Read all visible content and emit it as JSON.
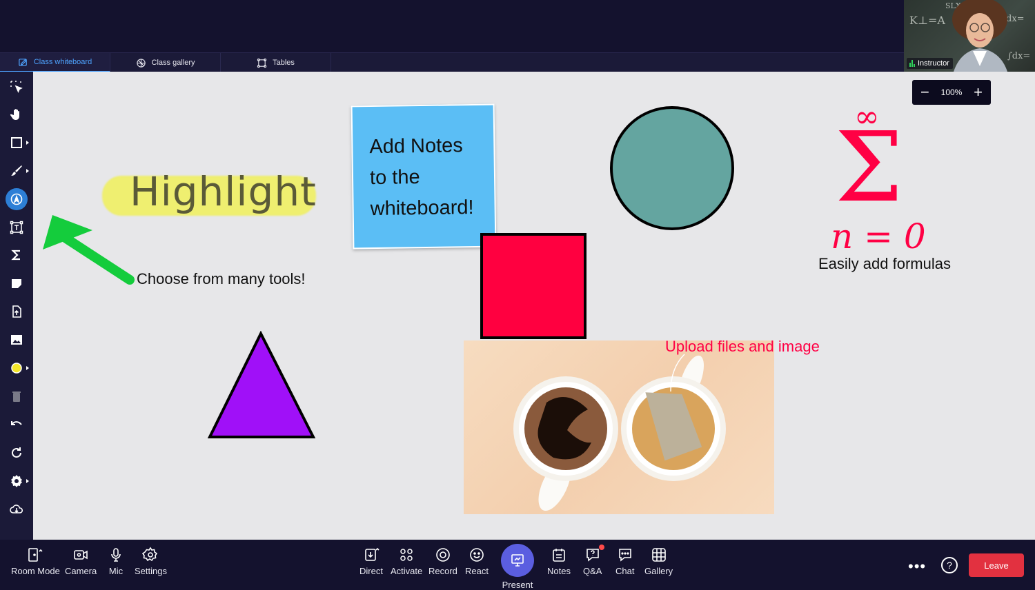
{
  "tabs": [
    {
      "label": "Class whiteboard",
      "icon": "whiteboard-icon",
      "active": true
    },
    {
      "label": "Class gallery",
      "icon": "grid-icon",
      "active": false
    },
    {
      "label": "Tables",
      "icon": "tables-icon",
      "active": false
    }
  ],
  "instructor": {
    "label": "Instructor"
  },
  "zoom": {
    "value": "100%",
    "minus": "−",
    "plus": "+"
  },
  "canvas": {
    "highlight_text": "Highlight",
    "tools_text": "Choose from many tools!",
    "sticky_lines": [
      "Add Notes",
      "to the",
      "whiteboard!"
    ],
    "formula_top": "∞",
    "formula_sigma": "Σ",
    "formula_bottom": "n = 0",
    "formula_label": "Easily add formulas",
    "upload_label": "Upload files and image"
  },
  "bottom_left": [
    {
      "label": "Room Mode",
      "icon": "room-mode-icon"
    },
    {
      "label": "Camera",
      "icon": "camera-icon"
    },
    {
      "label": "Mic",
      "icon": "mic-icon"
    },
    {
      "label": "Settings",
      "icon": "settings-icon"
    }
  ],
  "bottom_center": [
    {
      "label": "Direct",
      "icon": "direct-icon"
    },
    {
      "label": "Activate",
      "icon": "activate-icon"
    },
    {
      "label": "Record",
      "icon": "record-icon"
    },
    {
      "label": "React",
      "icon": "react-icon"
    },
    {
      "label": "Present",
      "icon": "present-icon"
    },
    {
      "label": "Notes",
      "icon": "notes-icon"
    },
    {
      "label": "Q&A",
      "icon": "qa-icon"
    },
    {
      "label": "Chat",
      "icon": "chat-icon"
    },
    {
      "label": "Gallery",
      "icon": "gallery-icon"
    }
  ],
  "bottom_right": {
    "more": "•••",
    "help": "?",
    "leave": "Leave"
  },
  "colors": {
    "accent": "#4ea4ff",
    "sticky": "#5bbef5",
    "red": "#ff0040",
    "circle": "#64a5a0",
    "purple": "#a010f8",
    "formula": "#ff0044",
    "leave": "#e23140",
    "present": "#5b5ee0"
  }
}
